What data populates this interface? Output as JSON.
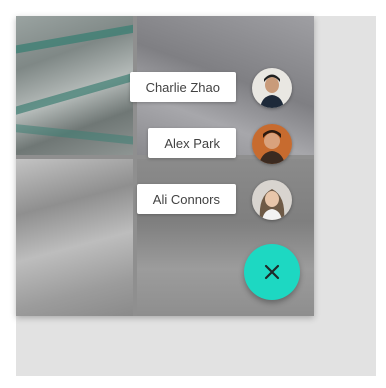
{
  "contacts": [
    {
      "name": "Charlie Zhao"
    },
    {
      "name": "Alex Park"
    },
    {
      "name": "Ali Connors"
    }
  ],
  "fab": {
    "icon": "close-icon",
    "color": "#1dd8c2"
  }
}
